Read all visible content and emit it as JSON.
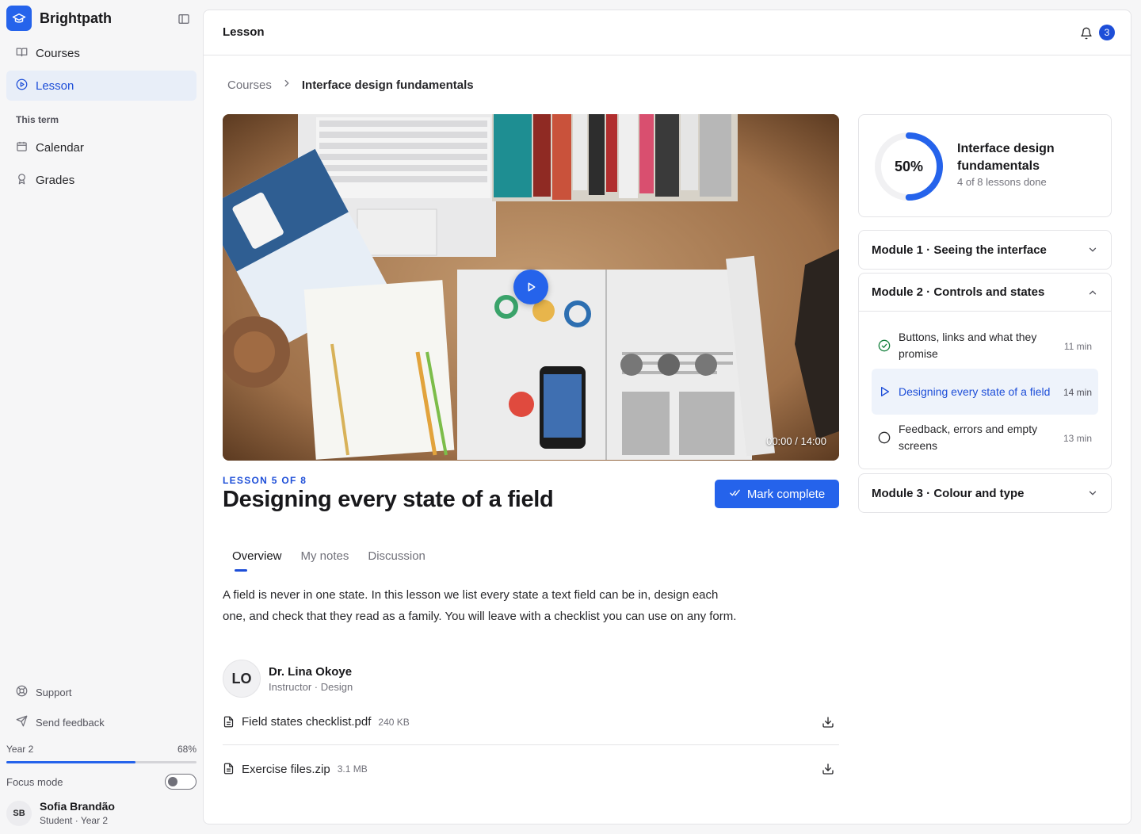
{
  "app": {
    "name": "Brightpath"
  },
  "sidebar": {
    "items": [
      {
        "label": "Courses",
        "icon": "book-icon"
      },
      {
        "label": "Lesson",
        "icon": "play-circle-icon",
        "active": true
      }
    ],
    "section_title": "This term",
    "section_items": [
      {
        "label": "Calendar",
        "icon": "calendar-icon"
      },
      {
        "label": "Grades",
        "icon": "award-icon"
      }
    ],
    "footer_links": [
      {
        "label": "Support",
        "icon": "lifebuoy-icon"
      },
      {
        "label": "Send feedback",
        "icon": "send-icon"
      }
    ],
    "year": {
      "label": "Year 2",
      "percent_text": "68%",
      "progress": 0.68
    },
    "focus_mode": {
      "label": "Focus mode",
      "on": false
    },
    "user": {
      "initials": "SB",
      "name": "Sofia Brandão",
      "role": "Student · Year 2"
    }
  },
  "header": {
    "title": "Lesson",
    "notifications": "3"
  },
  "breadcrumb": {
    "parent": "Courses",
    "current": "Interface design fundamentals"
  },
  "video": {
    "time": "00:00 / 14:00"
  },
  "lesson": {
    "eyebrow": "LESSON 5 OF 8",
    "title": "Designing every state of a field",
    "mark_complete": "Mark complete"
  },
  "tabs": [
    {
      "label": "Overview",
      "active": true
    },
    {
      "label": "My notes"
    },
    {
      "label": "Discussion"
    }
  ],
  "overview_text": "A field is never in one state. In this lesson we list every state a text field can be in, design each one, and check that they read as a family. You will leave with a checklist you can use on any form.",
  "instructor": {
    "initials": "LO",
    "name": "Dr. Lina Okoye",
    "role": "Instructor · Design"
  },
  "files": [
    {
      "name": "Field states checklist.pdf",
      "size": "240 KB"
    },
    {
      "name": "Exercise files.zip",
      "size": "3.1 MB"
    }
  ],
  "course_progress": {
    "percent_text": "50%",
    "progress": 0.5,
    "title": "Interface design fundamentals",
    "subtitle": "4 of 8 lessons done"
  },
  "modules": [
    {
      "title": "Module 1 · Seeing the interface",
      "open": false
    },
    {
      "title": "Module 2 · Controls and states",
      "open": true,
      "lessons": [
        {
          "title": "Buttons, links and what they promise",
          "duration": "11 min",
          "status": "done"
        },
        {
          "title": "Designing every state of a field",
          "duration": "14 min",
          "status": "current"
        },
        {
          "title": "Feedback, errors and empty screens",
          "duration": "13 min",
          "status": "todo"
        }
      ]
    },
    {
      "title": "Module 3 · Colour and type",
      "open": false
    }
  ],
  "colors": {
    "accent": "#2563eb",
    "accent_dark": "#1d4ed8",
    "success": "#15803d"
  }
}
